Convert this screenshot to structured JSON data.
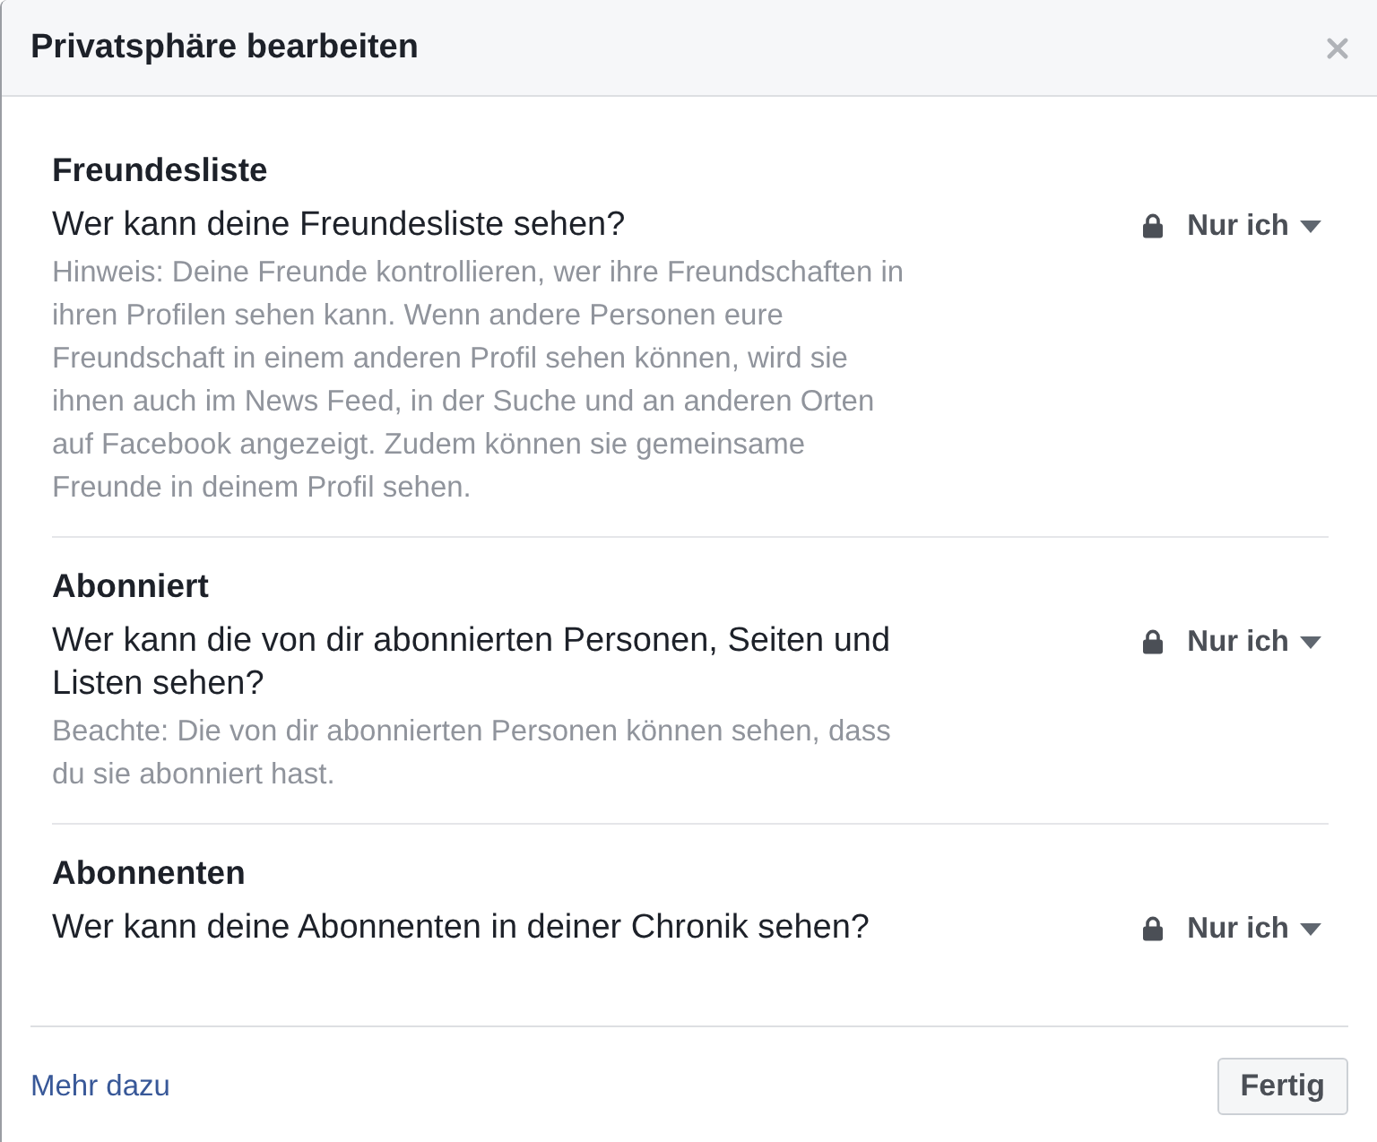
{
  "dialog": {
    "title": "Privatsphäre bearbeiten"
  },
  "sections": [
    {
      "heading": "Freundesliste",
      "question": "Wer kann deine Freundesliste sehen?",
      "hint": "Hinweis: Deine Freunde kontrollieren, wer ihre Freundschaften in ihren Profilen sehen kann. Wenn andere Personen eure Freundschaft in einem anderen Profil sehen können, wird sie ihnen auch im News Feed, in der Suche und an anderen Orten auf Facebook angezeigt. Zudem können sie gemeinsame Freunde in deinem Profil sehen.",
      "audience": "Nur ich"
    },
    {
      "heading": "Abonniert",
      "question": "Wer kann die von dir abonnierten Personen, Seiten und Listen sehen?",
      "hint": "Beachte: Die von dir abonnierten Personen können sehen, dass du sie abonniert hast.",
      "audience": "Nur ich"
    },
    {
      "heading": "Abonnenten",
      "question": "Wer kann deine Abonnenten in deiner Chronik sehen?",
      "audience": "Nur ich"
    }
  ],
  "footer": {
    "link": "Mehr dazu",
    "button": "Fertig"
  }
}
